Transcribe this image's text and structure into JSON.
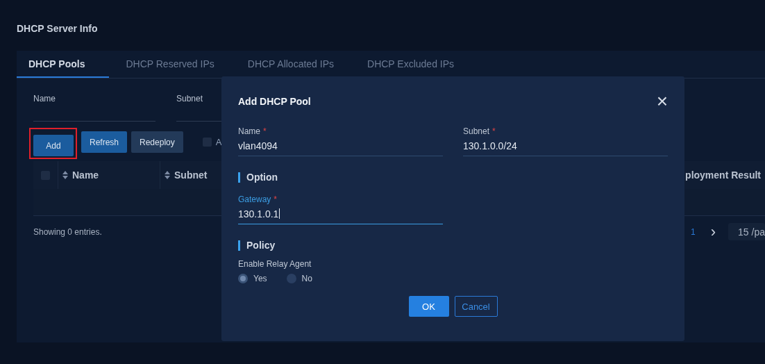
{
  "page": {
    "title": "DHCP Server Info"
  },
  "tabs": [
    {
      "label": "DHCP Pools",
      "selected": true
    },
    {
      "label": "DHCP Reserved IPs",
      "selected": false
    },
    {
      "label": "DHCP Allocated IPs",
      "selected": false
    },
    {
      "label": "DHCP Excluded IPs",
      "selected": false
    }
  ],
  "filters": [
    {
      "label": "Name"
    },
    {
      "label": "Subnet"
    }
  ],
  "toolbar": {
    "buttons": [
      {
        "label": "Add",
        "kind": "primary",
        "highlighted": true
      },
      {
        "label": "Refresh",
        "kind": "primary",
        "highlighted": false
      },
      {
        "label": "Redeploy",
        "kind": "secondary",
        "highlighted": false
      }
    ],
    "checkbox": {
      "label": "A",
      "checked": false
    }
  },
  "table": {
    "select_all": {
      "checked": false
    },
    "columns": [
      {
        "label": "Name"
      },
      {
        "label": "Subnet"
      }
    ],
    "last_column": "ployment Result"
  },
  "footer": {
    "summary": "Showing 0 entries.",
    "page": "1",
    "next": "›",
    "page_size": "15 /pa"
  },
  "dialog": {
    "title": "Add DHCP Pool",
    "close": "×",
    "fields": [
      {
        "label": "Name",
        "required_mark": "*",
        "value": "vlan4094",
        "focused": false
      },
      {
        "label": "Subnet",
        "required_mark": "*",
        "value": "130.1.0.0/24",
        "focused": false
      }
    ],
    "sections": [
      {
        "title": "Option",
        "fields": [
          {
            "label": "Gateway",
            "required_mark": "*",
            "value": "130.1.0.1",
            "focused": true
          }
        ]
      },
      {
        "title": "Policy",
        "radio_group": {
          "label": "Enable Relay Agent",
          "options": [
            {
              "label": "Yes",
              "selected": true
            },
            {
              "label": "No",
              "selected": false
            }
          ]
        }
      }
    ],
    "buttons": [
      {
        "label": "OK",
        "kind": "primary"
      },
      {
        "label": "Cancel",
        "kind": "outline"
      }
    ]
  }
}
